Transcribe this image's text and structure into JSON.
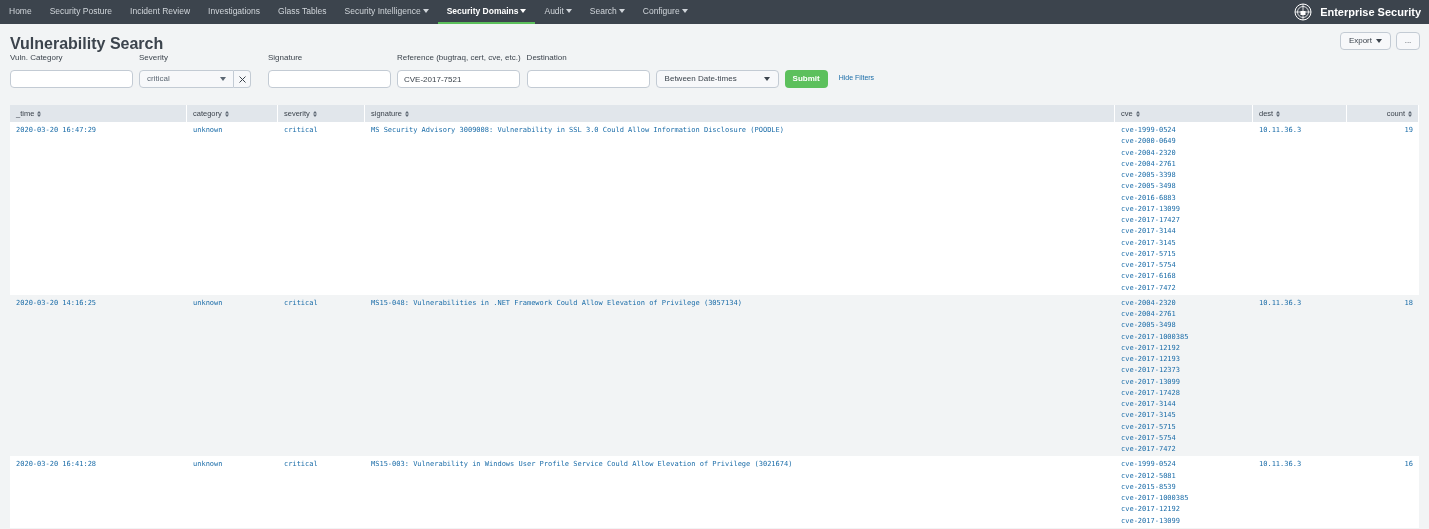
{
  "nav": {
    "items": [
      {
        "label": "Home",
        "dropdown": false,
        "selected": false
      },
      {
        "label": "Security Posture",
        "dropdown": false,
        "selected": false
      },
      {
        "label": "Incident Review",
        "dropdown": false,
        "selected": false
      },
      {
        "label": "Investigations",
        "dropdown": false,
        "selected": false
      },
      {
        "label": "Glass Tables",
        "dropdown": false,
        "selected": false
      },
      {
        "label": "Security Intelligence",
        "dropdown": true,
        "selected": false
      },
      {
        "label": "Security Domains",
        "dropdown": true,
        "selected": true
      },
      {
        "label": "Audit",
        "dropdown": true,
        "selected": false
      },
      {
        "label": "Search",
        "dropdown": true,
        "selected": false
      },
      {
        "label": "Configure",
        "dropdown": true,
        "selected": false
      }
    ],
    "app_name": "Enterprise Security"
  },
  "page": {
    "title": "Vulnerability Search",
    "export_button": "Export",
    "more_button": "..."
  },
  "filters": [
    {
      "kind": "text",
      "label": "Vuln. Category"
    },
    {
      "kind": "select",
      "label": "Severity",
      "value": "critical"
    },
    {
      "kind": "text",
      "label": "Signature"
    },
    {
      "kind": "text",
      "label": "Reference (bugtraq, cert, cve, etc.)",
      "value": "CVE-2017-7521"
    },
    {
      "kind": "text",
      "label": "Destination"
    },
    {
      "kind": "dropdown",
      "value": "Between Date-times"
    }
  ],
  "submit_button": "Submit",
  "hide_filters_link": "Hide Filters",
  "table": {
    "columns": [
      "_time",
      "category",
      "severity",
      "signature",
      "cve",
      "dest",
      "count"
    ],
    "rows": [
      {
        "time": "2020-03-20 16:47:29",
        "category": "unknown",
        "severity": "critical",
        "signature": "MS Security Advisory 3009008: Vulnerability in SSL 3.0 Could Allow Information Disclosure (POODLE)",
        "cve": [
          "cve-1999-0524",
          "cve-2000-0649",
          "cve-2004-2320",
          "cve-2004-2761",
          "cve-2005-3398",
          "cve-2005-3498",
          "cve-2016-6883",
          "cve-2017-13099",
          "cve-2017-17427",
          "cve-2017-3144",
          "cve-2017-3145",
          "cve-2017-5715",
          "cve-2017-5754",
          "cve-2017-6168",
          "cve-2017-7472"
        ],
        "dest": "10.11.36.3",
        "count": "19"
      },
      {
        "time": "2020-03-20 14:16:25",
        "category": "unknown",
        "severity": "critical",
        "signature": "MS15-048: Vulnerabilities in .NET Framework Could Allow Elevation of Privilege (3057134)",
        "cve": [
          "cve-2004-2320",
          "cve-2004-2761",
          "cve-2005-3498",
          "cve-2017-1000385",
          "cve-2017-12192",
          "cve-2017-12193",
          "cve-2017-12373",
          "cve-2017-13099",
          "cve-2017-17428",
          "cve-2017-3144",
          "cve-2017-3145",
          "cve-2017-5715",
          "cve-2017-5754",
          "cve-2017-7472"
        ],
        "dest": "10.11.36.3",
        "count": "18"
      },
      {
        "time": "2020-03-20 16:41:28",
        "category": "unknown",
        "severity": "critical",
        "signature": "MS15-003: Vulnerability in Windows User Profile Service Could Allow Elevation of Privilege (3021674)",
        "cve": [
          "cve-1999-0524",
          "cve-2012-5081",
          "cve-2015-8539",
          "cve-2017-1000385",
          "cve-2017-12192",
          "cve-2017-13099"
        ],
        "dest": "10.11.36.3",
        "count": "16"
      }
    ]
  }
}
